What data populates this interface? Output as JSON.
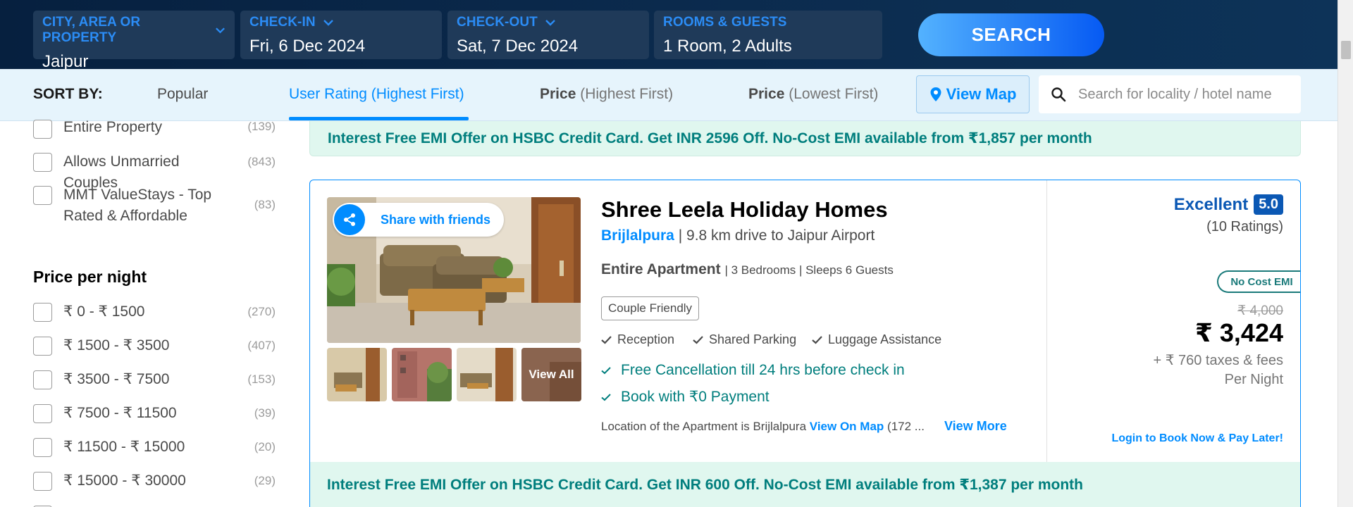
{
  "search": {
    "city_label": "CITY, AREA OR PROPERTY",
    "city_value": "Jaipur",
    "checkin_label": "CHECK-IN",
    "checkin_value": "Fri, 6 Dec 2024",
    "checkout_label": "CHECK-OUT",
    "checkout_value": "Sat, 7 Dec 2024",
    "rooms_label": "ROOMS & GUESTS",
    "rooms_value": "1 Room, 2 Adults",
    "button": "SEARCH"
  },
  "sort": {
    "label": "SORT BY:",
    "options": [
      {
        "main": "Popular",
        "sub": ""
      },
      {
        "main": "User Rating",
        "sub": "(Highest First)"
      },
      {
        "main": "Price",
        "sub": "(Highest First)"
      },
      {
        "main": "Price",
        "sub": "(Lowest First)"
      }
    ],
    "active": "User Rating",
    "view_map": "View Map",
    "search_placeholder": "Search for locality / hotel name"
  },
  "filters": {
    "property": [
      {
        "label": "Entire Property",
        "count": "(139)"
      },
      {
        "label": "Allows Unmarried Couples",
        "count": "(843)"
      },
      {
        "label": "MMT ValueStays - Top Rated & Affordable",
        "count": "(83)"
      }
    ],
    "price_title": "Price per night",
    "price": [
      {
        "label": "₹ 0 - ₹ 1500",
        "count": "(270)"
      },
      {
        "label": "₹ 1500 - ₹ 3500",
        "count": "(407)"
      },
      {
        "label": "₹ 3500 - ₹ 7500",
        "count": "(153)"
      },
      {
        "label": "₹ 7500 - ₹ 11500",
        "count": "(39)"
      },
      {
        "label": "₹ 11500 - ₹ 15000",
        "count": "(20)"
      },
      {
        "label": "₹ 15000 - ₹ 30000",
        "count": "(29)"
      }
    ]
  },
  "emi_top": "Interest Free EMI Offer on HSBC Credit Card. Get INR 2596 Off. No-Cost EMI available from ₹1,857 per month",
  "hotel": {
    "share": "Share with friends",
    "view_all": "View All",
    "name": "Shree Leela Holiday Homes",
    "area": "Brijlalpura",
    "distance": "| 9.8 km drive to Jaipur Airport",
    "type": "Entire Apartment",
    "details": "| 3 Bedrooms | Sleeps 6 Guests",
    "tag": "Couple Friendly",
    "amenities": [
      "Reception",
      "Shared Parking",
      "Luggage Assistance"
    ],
    "perks": [
      "Free Cancellation till 24 hrs before check in",
      "Book with ₹0 Payment"
    ],
    "location_text": "Location of the Apartment is Brijlalpura",
    "view_on_map": "View On Map",
    "location_tail": "(172 ...",
    "view_more": "View More",
    "rating_text": "Excellent",
    "rating_score": "5.0",
    "rating_count": "(10 Ratings)",
    "no_cost_emi": "No Cost EMI",
    "old_price": "₹ 4,000",
    "price": "₹ 3,424",
    "taxes": "+ ₹ 760 taxes & fees",
    "per_night": "Per Night",
    "login_cta": "Login to Book Now & Pay Later!",
    "emi": "Interest Free EMI Offer on HSBC Credit Card. Get INR 600 Off. No-Cost EMI available from ₹1,387 per month"
  },
  "colors": {
    "accent": "#008cff",
    "header_bg": "#0b2a4d",
    "emi_green": "#007e7d",
    "rating_blue": "#0b58b4"
  }
}
